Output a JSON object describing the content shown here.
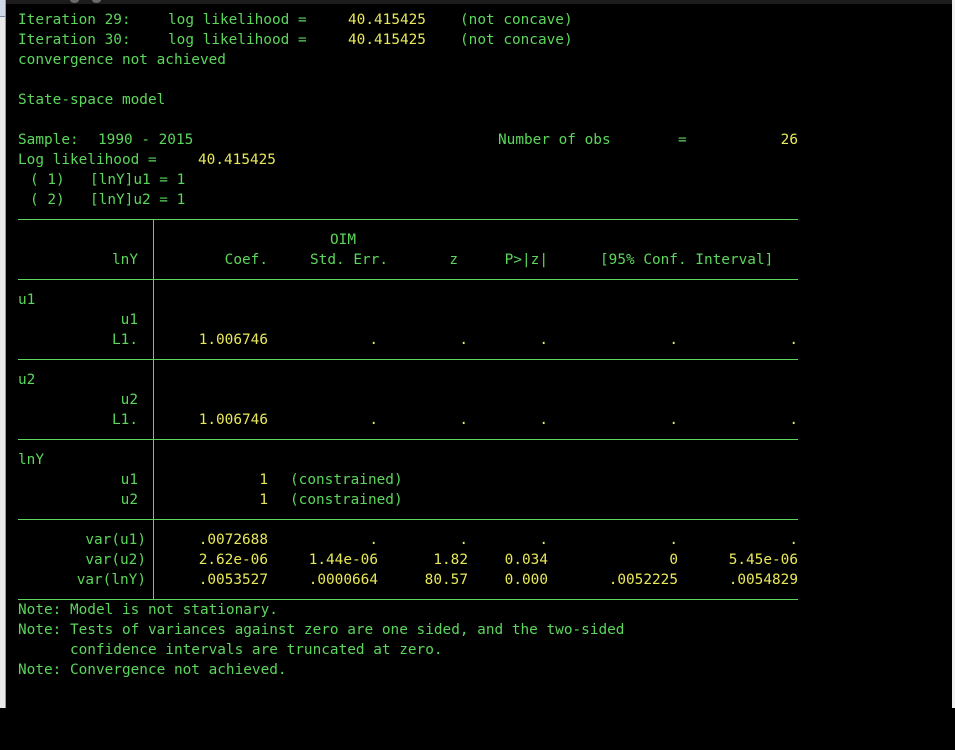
{
  "iterations": [
    {
      "label": "Iteration 29:",
      "ll_label": "log likelihood =",
      "value": "40.415425",
      "note": "(not concave)"
    },
    {
      "label": "Iteration 30:",
      "ll_label": "log likelihood =",
      "value": "40.415425",
      "note": "(not concave)"
    }
  ],
  "convergence_message": "convergence not achieved",
  "model_title": "State-space model",
  "sample": {
    "label": "Sample:",
    "value": "1990 - 2015"
  },
  "nobs": {
    "label": "Number of obs",
    "eq": "=",
    "value": "26"
  },
  "loglik": {
    "label": "Log likelihood =",
    "value": "40.415425"
  },
  "constraints": [
    {
      "num": "( 1)",
      "text": "[lnY]u1 = 1"
    },
    {
      "num": "( 2)",
      "text": "[lnY]u2 = 1"
    }
  ],
  "table": {
    "oim_label": "OIM",
    "depvar": "lnY",
    "headers": [
      "Coef.",
      "Std. Err.",
      "z",
      "P>|z|",
      "[95% Conf. Interval]"
    ],
    "groups": [
      {
        "name": "u1",
        "sub": "u1",
        "lag": "L1.",
        "coef": "1.006746",
        "se": ".",
        "z": ".",
        "p": ".",
        "lo": ".",
        "hi": "."
      },
      {
        "name": "u2",
        "sub": "u2",
        "lag": "L1.",
        "coef": "1.006746",
        "se": ".",
        "z": ".",
        "p": ".",
        "lo": ".",
        "hi": "."
      }
    ],
    "lnY_group": {
      "name": "lnY",
      "rows": [
        {
          "label": "u1",
          "coef": "1",
          "note": "(constrained)"
        },
        {
          "label": "u2",
          "coef": "1",
          "note": "(constrained)"
        }
      ]
    },
    "var_rows": [
      {
        "label": "var(u1)",
        "coef": ".0072688",
        "se": ".",
        "z": ".",
        "p": ".",
        "lo": ".",
        "hi": "."
      },
      {
        "label": "var(u2)",
        "coef": "2.62e-06",
        "se": "1.44e-06",
        "z": "1.82",
        "p": "0.034",
        "lo": "0",
        "hi": "5.45e-06"
      },
      {
        "label": "var(lnY)",
        "coef": ".0053527",
        "se": ".0000664",
        "z": "80.57",
        "p": "0.000",
        "lo": ".0052225",
        "hi": ".0054829"
      }
    ]
  },
  "notes": [
    "Note: Model is not stationary.",
    "Note: Tests of variances against zero are one sided, and the two-sided",
    "      confidence intervals are truncated at zero.",
    "Note: Convergence not achieved."
  ],
  "colors": {
    "background": "#000000",
    "text": "#5cd65c",
    "result": "#e8e85a"
  }
}
